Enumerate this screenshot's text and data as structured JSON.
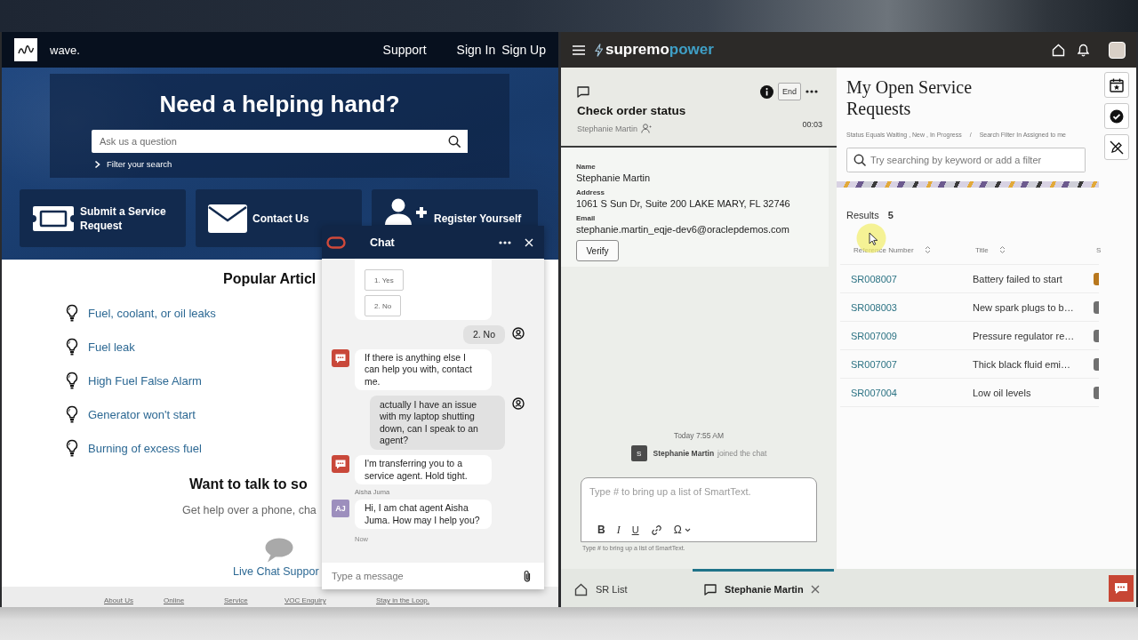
{
  "site": {
    "logo_text": "wave.",
    "nav": [
      "Support",
      "Sign In",
      "Sign Up"
    ],
    "hero": {
      "title": "Need a helping hand?",
      "search": {
        "placeholder": "Ask us a question"
      },
      "filter_link": "Filter your search"
    },
    "tiles": [
      {
        "kind": "ticket",
        "label": "Submit a Service Request"
      },
      {
        "kind": "mail",
        "label": "Contact Us"
      },
      {
        "kind": "register",
        "label": "Register Yourself"
      }
    ],
    "popular": {
      "title": "Popular Articl",
      "articles": [
        "Fuel, coolant, or oil leaks",
        "Fuel leak",
        "High Fuel False Alarm",
        "Generator won't start",
        "Burning of excess fuel"
      ]
    },
    "contact": {
      "title": "Want to talk to so",
      "subtitle": "Get help over a phone, cha",
      "link": "Live Chat Suppor"
    },
    "footer_links": [
      "About Us",
      "Online",
      "Service",
      "VOC Enquiry",
      "Stay in the Loop."
    ]
  },
  "chat_widget": {
    "title": "Chat",
    "messages": [
      {
        "kind": "options",
        "options": [
          "1. Yes",
          "2. No"
        ]
      },
      {
        "kind": "user",
        "text": "2. No"
      },
      {
        "kind": "bot",
        "text": "If there is anything else I can help you with, contact me."
      },
      {
        "kind": "user",
        "text": "actually I have an issue with my laptop shutting down, can I speak to an agent?"
      },
      {
        "kind": "bot",
        "text": "I'm transferring you to a service agent. Hold tight."
      },
      {
        "kind": "agent",
        "sender": "Aisha Juma",
        "initials": "AJ",
        "text": "Hi, I am chat agent Aisha Juma. How may I help you?",
        "time": "Now"
      }
    ],
    "input": {
      "placeholder": "Type a message"
    }
  },
  "app": {
    "brand": {
      "name": "supremo",
      "accent": "power"
    },
    "conversation": {
      "title": "Check order status",
      "customer": "Stephanie Martin",
      "end_button": "End",
      "timer": "00:03"
    },
    "contact_details": {
      "fields": [
        {
          "label": "Name",
          "value": "Stephanie Martin"
        },
        {
          "label": "Address",
          "value": "1061 S Sun Dr, Suite 200 LAKE MARY, FL 32746"
        },
        {
          "label": "Email",
          "value": "stephanie.martin_eqje-dev6@oraclepdemos.com"
        }
      ],
      "verify_button": "Verify"
    },
    "transcript": {
      "timestamp": "Today 7:55 AM",
      "event": {
        "initial": "S",
        "name": "Stephanie Martin",
        "text": "joined the chat"
      }
    },
    "composer": {
      "placeholder": "Type # to bring up a list of SmartText.",
      "tools": [
        {
          "kind": "bold",
          "label": "B"
        },
        {
          "kind": "italic",
          "label": "I"
        },
        {
          "kind": "underline",
          "label": "U"
        },
        {
          "kind": "link"
        },
        {
          "kind": "special_characters",
          "label": "Ω"
        }
      ],
      "hint": "Type # to bring up a list of SmartText."
    },
    "bottom_tabs": [
      {
        "kind": "home",
        "label": "SR List",
        "selected": false,
        "closable": false
      },
      {
        "kind": "chat",
        "label": "Stephanie Martin",
        "selected": true,
        "closable": true
      }
    ],
    "requests": {
      "title": "My Open Service Requests",
      "filter_summary": {
        "parts": [
          "Status Equals Waiting , New , In Progress",
          "Search Filter In Assigned to me"
        ],
        "separator": "/"
      },
      "search": {
        "placeholder": "Try searching by keyword or add a filter"
      },
      "results_label": "Results",
      "results_count": "5",
      "columns": [
        {
          "label": "Reference Number",
          "sortable": true
        },
        {
          "label": "Title",
          "sortable": true
        },
        {
          "label": "S",
          "sortable": false
        }
      ],
      "rows": [
        {
          "reference": "SR008007",
          "title": "Battery failed to start",
          "color": "#b8771d"
        },
        {
          "reference": "SR008003",
          "title": "New spark plugs to b…",
          "color": "#707070"
        },
        {
          "reference": "SR007009",
          "title": "Pressure regulator re…",
          "color": "#707070"
        },
        {
          "reference": "SR007007",
          "title": "Thick black fluid emi…",
          "color": "#707070"
        },
        {
          "reference": "SR007004",
          "title": "Low oil levels",
          "color": "#707070"
        }
      ]
    }
  }
}
